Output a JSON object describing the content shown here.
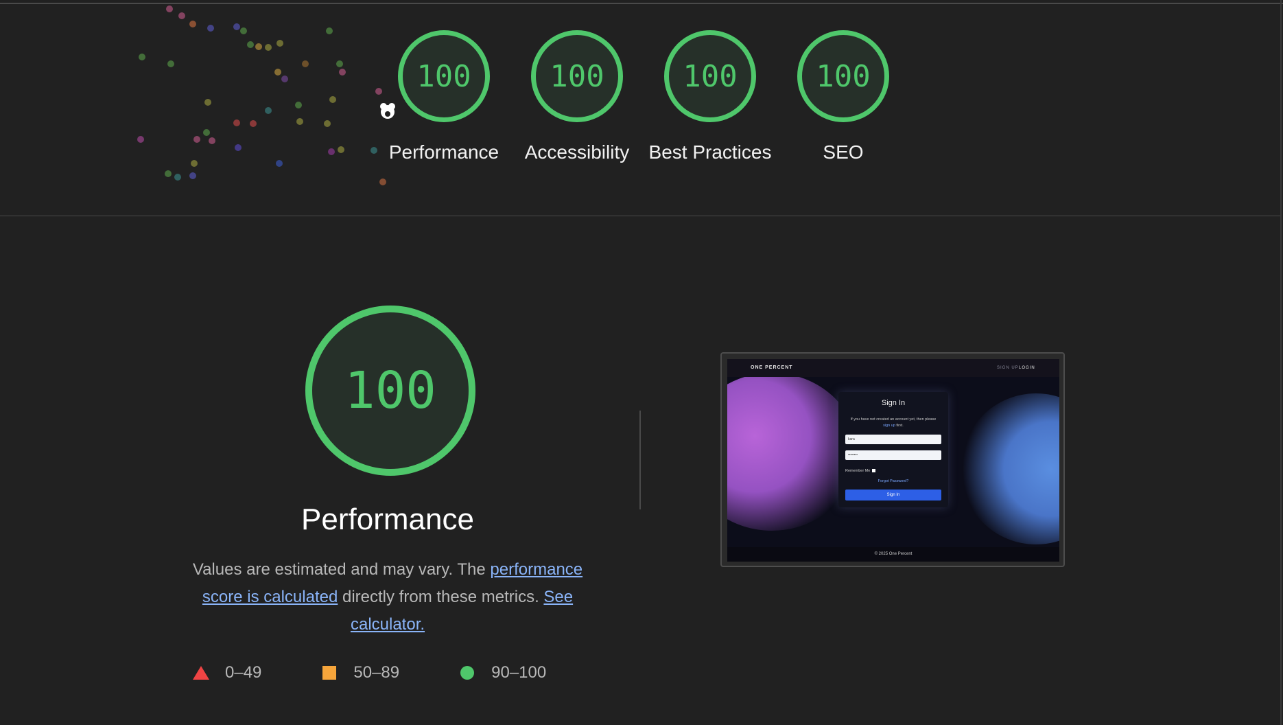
{
  "colors": {
    "background": "#212121",
    "pass": "#4fc76b",
    "average": "#f6a53b",
    "fail": "#ef4444",
    "link": "#8ab4f8"
  },
  "top_gauges": [
    {
      "score": "100",
      "label": "Performance"
    },
    {
      "score": "100",
      "label": "Accessibility"
    },
    {
      "score": "100",
      "label": "Best Practices"
    },
    {
      "score": "100",
      "label": "SEO"
    }
  ],
  "performance": {
    "score": "100",
    "title": "Performance",
    "description": {
      "text1": "Values are estimated and may vary. The ",
      "link1": "performance score is calculated",
      "text2": " directly from these metrics. ",
      "link2": "See calculator."
    }
  },
  "legend": [
    {
      "icon": "triangle-icon",
      "range": "0–49"
    },
    {
      "icon": "square-icon",
      "range": "50–89"
    },
    {
      "icon": "circle-icon",
      "range": "90–100"
    }
  ],
  "thumbnail": {
    "brand": "ONE PERCENT",
    "nav_signup": "SIGN UP",
    "nav_login": "LOGIN",
    "card_title": "Sign In",
    "card_info_1": "If you have not created an account yet, then please ",
    "card_info_link": "sign up",
    "card_info_2": " first.",
    "username_value": "kara",
    "password_value": "••••••••",
    "remember_label": "Remember Me",
    "forgot_link": "Forgot Password?",
    "submit_label": "Sign In",
    "footer_text": "© 2025 One Percent"
  }
}
